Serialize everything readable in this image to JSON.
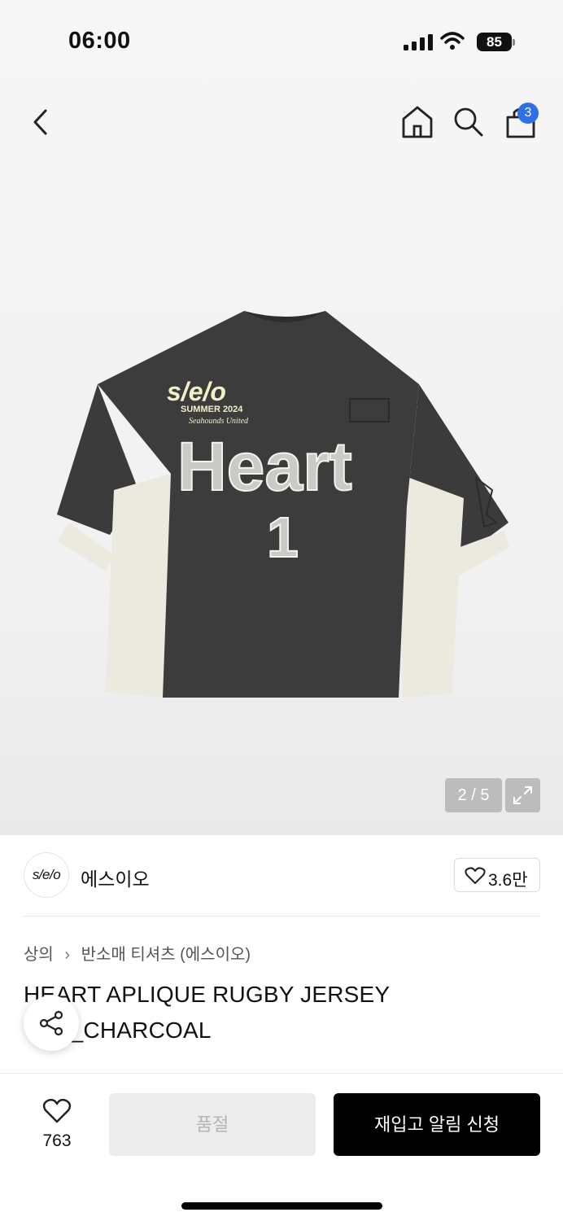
{
  "status_bar": {
    "time": "06:00",
    "battery": "85"
  },
  "nav": {
    "cart_count": "3"
  },
  "product_image": {
    "brand_mark": "s/e/o",
    "season": "SUMMER 2024",
    "tagline": "Seahounds United",
    "chest_word": "Heart",
    "number": "1"
  },
  "gallery": {
    "counter": "2 / 5"
  },
  "brand": {
    "logo_text": "s/e/o",
    "name": "에스이오",
    "likes": "3.6만"
  },
  "breadcrumb": {
    "category": "상의",
    "subcategory": "반소매 티셔츠 (에스이오)"
  },
  "product": {
    "title": "HEART APLIQUE RUGBY JERSEY TOP_CHARCOAL"
  },
  "bottom_bar": {
    "wish_count": "763",
    "soldout_label": "품절",
    "restock_label": "재입고 알림 신청"
  },
  "colors": {
    "accent_badge": "#2f6fe8",
    "jersey": "#3b3c3b",
    "panel": "#ece9df"
  }
}
